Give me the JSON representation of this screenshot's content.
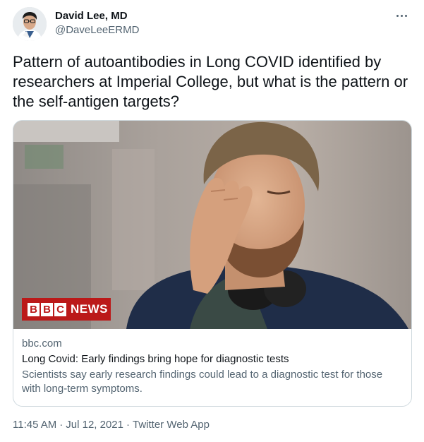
{
  "author": {
    "display_name": "David Lee, MD",
    "handle": "@DaveLeeERMD",
    "avatar_icon": "person-avatar"
  },
  "tweet": {
    "text": "Pattern of autoantibodies in Long COVID identified by researchers at Imperial College, but what is the pattern or the self-antigen targets?"
  },
  "card": {
    "image_description_icon": "man-rubbing-eye-photo",
    "brand": {
      "blocks": [
        "B",
        "B",
        "C"
      ],
      "word": "NEWS",
      "color": "#bb1919"
    },
    "domain": "bbc.com",
    "title": "Long Covid: Early findings bring hope for diagnostic tests",
    "description": "Scientists say early research findings could lead to a diagnostic test for those with long-term symptoms."
  },
  "meta": {
    "time": "11:45 AM",
    "separator": "·",
    "date": "Jul 12, 2021",
    "source": "Twitter Web App"
  },
  "colors": {
    "text_primary": "#0f1419",
    "text_secondary": "#536471",
    "border": "#cfd9de"
  }
}
